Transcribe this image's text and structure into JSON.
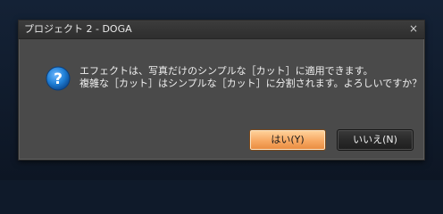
{
  "dialog": {
    "title": "プロジェクト 2 - DOGA",
    "close_glyph": "×",
    "icon": "question-icon",
    "message_line1": "エフェクトは、写真だけのシンプルな［カット］に適用できます。",
    "message_line2": "複雑な［カット］はシンプルな［カット］に分割されます。よろしいですか？",
    "yes_label": "はい(Y)",
    "no_label": "いいえ(N)"
  },
  "colors": {
    "dialog_bg": "#4a4a4a",
    "titlebar_bg": "#333333",
    "yes_button_accent": "#f7a862",
    "icon_blue": "#1f7fd6"
  }
}
